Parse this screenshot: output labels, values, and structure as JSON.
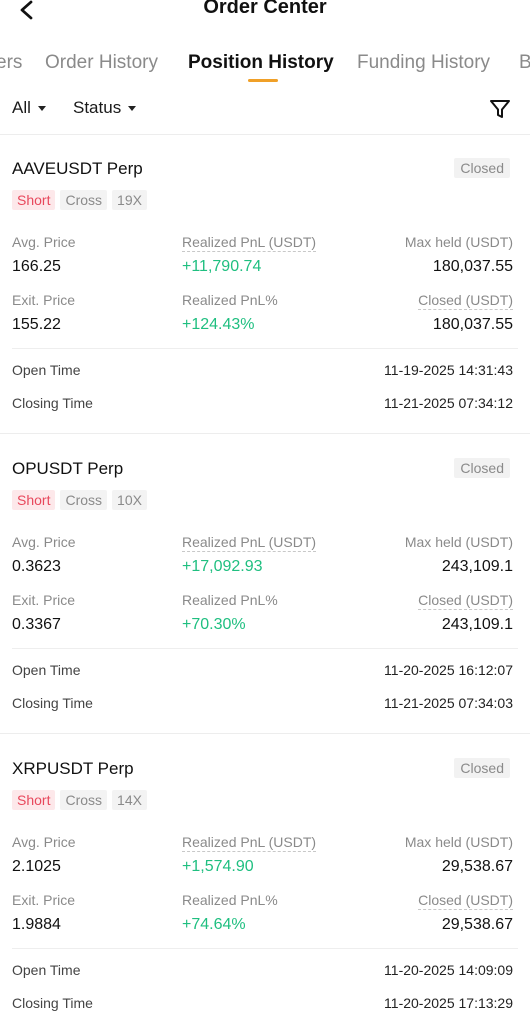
{
  "header": {
    "title": "Order Center"
  },
  "tabs": [
    "ers",
    "Order History",
    "Position History",
    "Funding History",
    "B"
  ],
  "filters": {
    "all": "All",
    "status": "Status"
  },
  "labels": {
    "avg_price": "Avg. Price",
    "realized_pnl": "Realized PnL (USDT)",
    "max_held": "Max held (USDT)",
    "exit_price": "Exit. Price",
    "realized_pnl_pct": "Realized PnL%",
    "closed_usdt": "Closed (USDT)",
    "open_time": "Open Time",
    "closing_time": "Closing Time"
  },
  "positions": [
    {
      "pair": "AAVEUSDT Perp",
      "status": "Closed",
      "side": "Short",
      "margin": "Cross",
      "leverage": "19X",
      "avg_price": "166.25",
      "realized_pnl": "+11,790.74",
      "max_held": "180,037.55",
      "exit_price": "155.22",
      "realized_pnl_pct": "+124.43%",
      "closed": "180,037.55",
      "open_time": "11-19-2025 14:31:43",
      "closing_time": "11-21-2025 07:34:12"
    },
    {
      "pair": "OPUSDT Perp",
      "status": "Closed",
      "side": "Short",
      "margin": "Cross",
      "leverage": "10X",
      "avg_price": "0.3623",
      "realized_pnl": "+17,092.93",
      "max_held": "243,109.1",
      "exit_price": "0.3367",
      "realized_pnl_pct": "+70.30%",
      "closed": "243,109.1",
      "open_time": "11-20-2025 16:12:07",
      "closing_time": "11-21-2025 07:34:03"
    },
    {
      "pair": "XRPUSDT Perp",
      "status": "Closed",
      "side": "Short",
      "margin": "Cross",
      "leverage": "14X",
      "avg_price": "2.1025",
      "realized_pnl": "+1,574.90",
      "max_held": "29,538.67",
      "exit_price": "1.9884",
      "realized_pnl_pct": "+74.64%",
      "closed": "29,538.67",
      "open_time": "11-20-2025 14:09:09",
      "closing_time": "11-20-2025 17:13:29"
    }
  ],
  "icons": {
    "back": "chevron-left-icon",
    "filter": "funnel-icon",
    "dropdown": "caret-down-icon"
  },
  "colors": {
    "accent": "#f0a028",
    "profit": "#1fbf80",
    "short": "#e8485c"
  }
}
